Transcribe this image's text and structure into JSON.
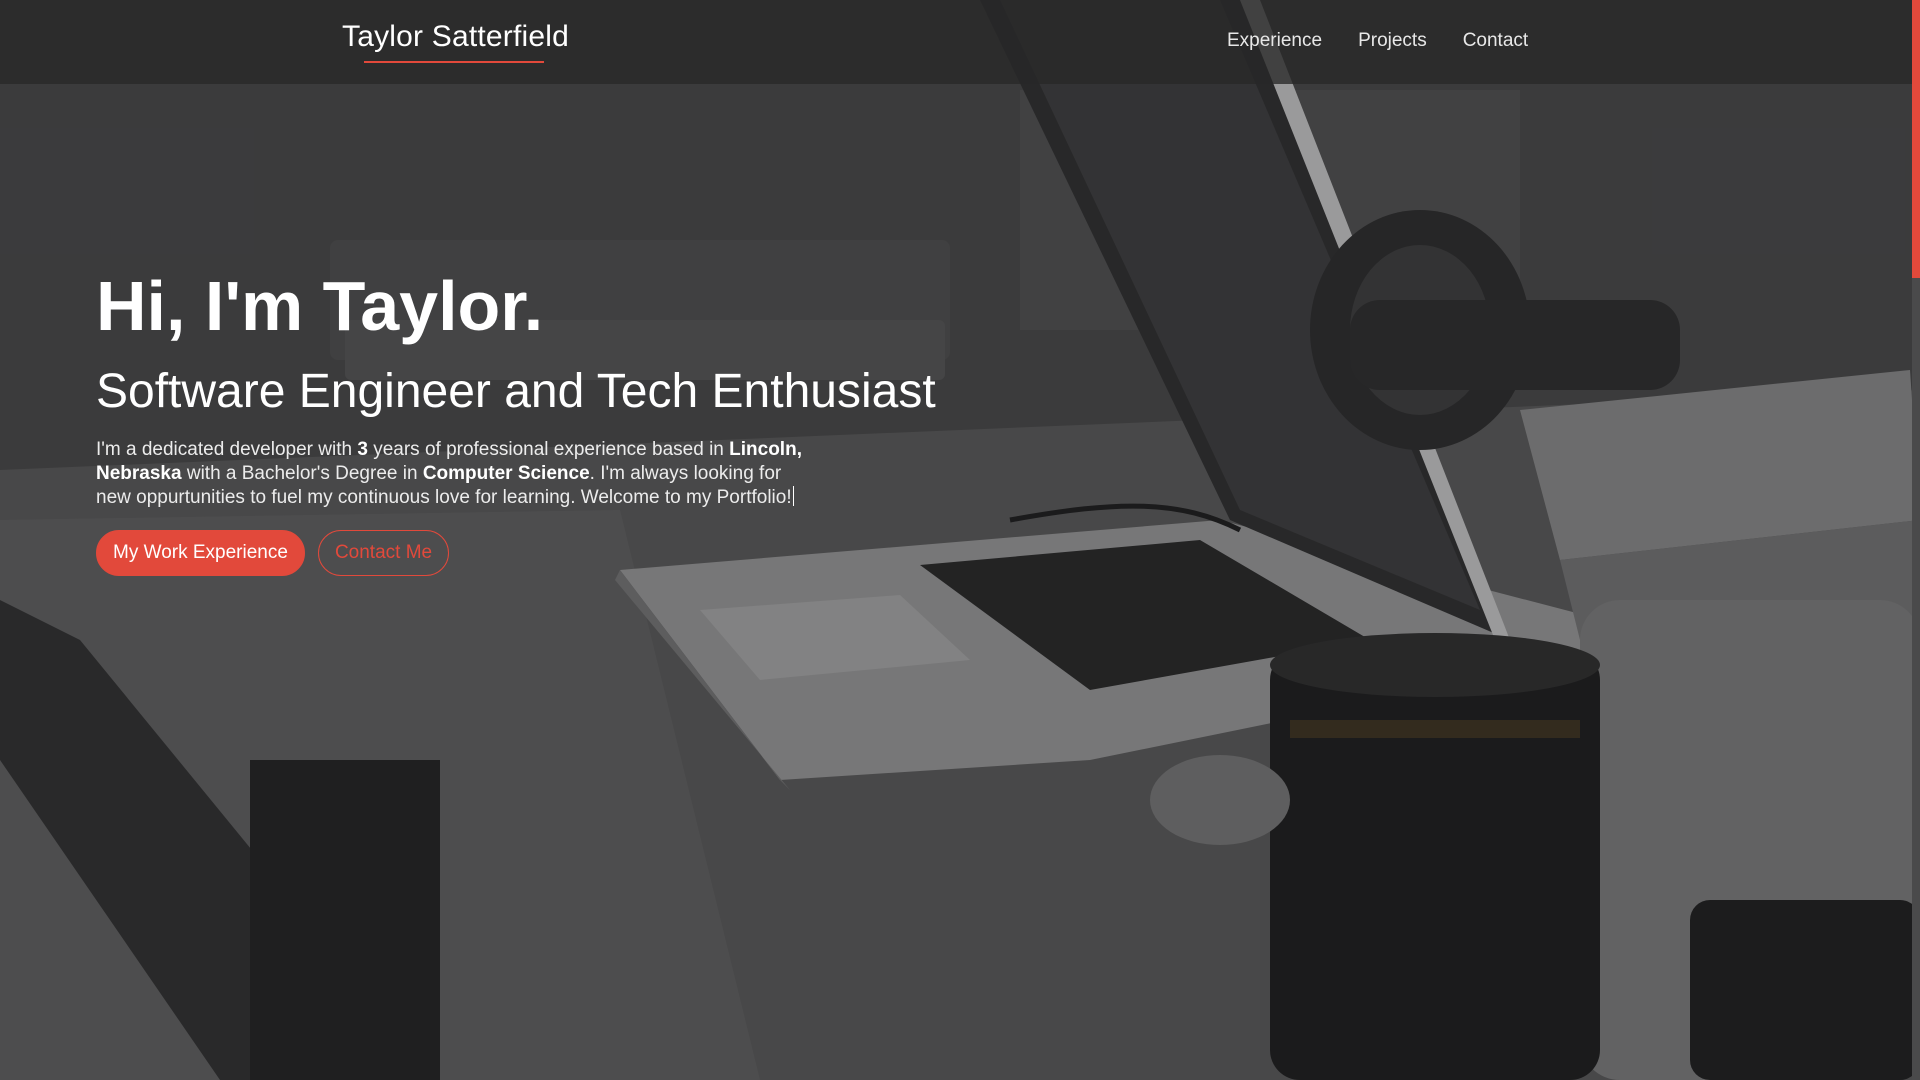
{
  "navbar": {
    "brand": "Taylor Satterfield",
    "links": [
      {
        "label": "Experience"
      },
      {
        "label": "Projects"
      },
      {
        "label": "Contact"
      }
    ]
  },
  "hero": {
    "title": "Hi, I'm Taylor.",
    "subtitle": "Software Engineer and Tech Enthusiast",
    "intro": {
      "t1": "I'm a dedicated developer with ",
      "years": "3",
      "t2": " years of professional experience based in ",
      "location": "Lincoln, Nebraska",
      "t3": " with a Bachelor's Degree in ",
      "degree": "Computer Science",
      "t4": ". I'm always looking for new oppurtunities to fuel my continuous love for learning. Welcome to my Portfolio!"
    },
    "buttons": {
      "primary": "My Work Experience",
      "secondary": "Contact Me"
    }
  },
  "theme": {
    "accent": "#e2493b",
    "navbar_bg": "#2b2b2b"
  }
}
